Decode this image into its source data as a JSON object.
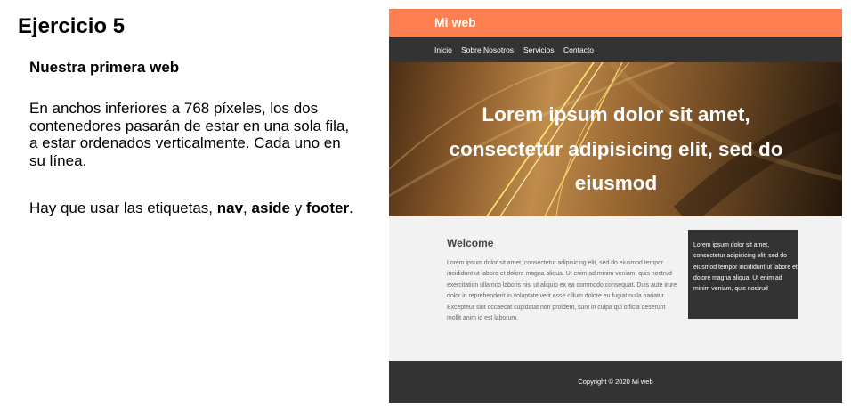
{
  "exercise": {
    "title": "Ejercicio 5",
    "subtitle": "Nuestra primera web",
    "paragraph1": "En anchos inferiores a 768 píxeles, los dos contenedores pasarán de estar en una sola fila, a estar ordenados verticalmente. Cada uno en su línea.",
    "paragraph2": {
      "intro": "Hay que usar las etiquetas, ",
      "tag1": "nav",
      "sep1": ", ",
      "tag2": "aside",
      "sep2": " y ",
      "tag3": "footer",
      "end": "."
    }
  },
  "preview": {
    "brand": "Mi web",
    "nav": [
      "Inicio",
      "Sobre Nosotros",
      "Servicios",
      "Contacto"
    ],
    "hero_text": "Lorem ipsum dolor sit amet, consectetur adipisicing elit, sed do eiusmod",
    "main": {
      "title": "Welcome",
      "text": "Lorem ipsum dolor sit amet, consectetur adipisicing elit, sed do eiusmod tempor incididunt ut labore et dolore magna aliqua. Ut enim ad minim veniam, quis nostrud exercitation ullamco laboris nisi ut aliquip ex ea commodo consequat. Duis aute irure dolor in reprehenderit in voluptate velit esse cillum dolore eu fugiat nulla pariatur. Excepteur sint occaecat cupidatat non proident, sunt in culpa qui officia deserunt mollit anim id est laborum."
    },
    "aside_text": "Lorem ipsum dolor sit amet, consectetur adipisicing elit, sed do eiusmod tempor incididunt ut labore et dolore magna aliqua. Ut enim ad minim veniam, quis nostrud",
    "footer_text": "Copyright © 2020 Mi web"
  },
  "colors": {
    "header": "#ff7f50",
    "nav": "#333333",
    "content_bg": "#f2f2f2",
    "aside": "#333333",
    "footer": "#333333"
  }
}
